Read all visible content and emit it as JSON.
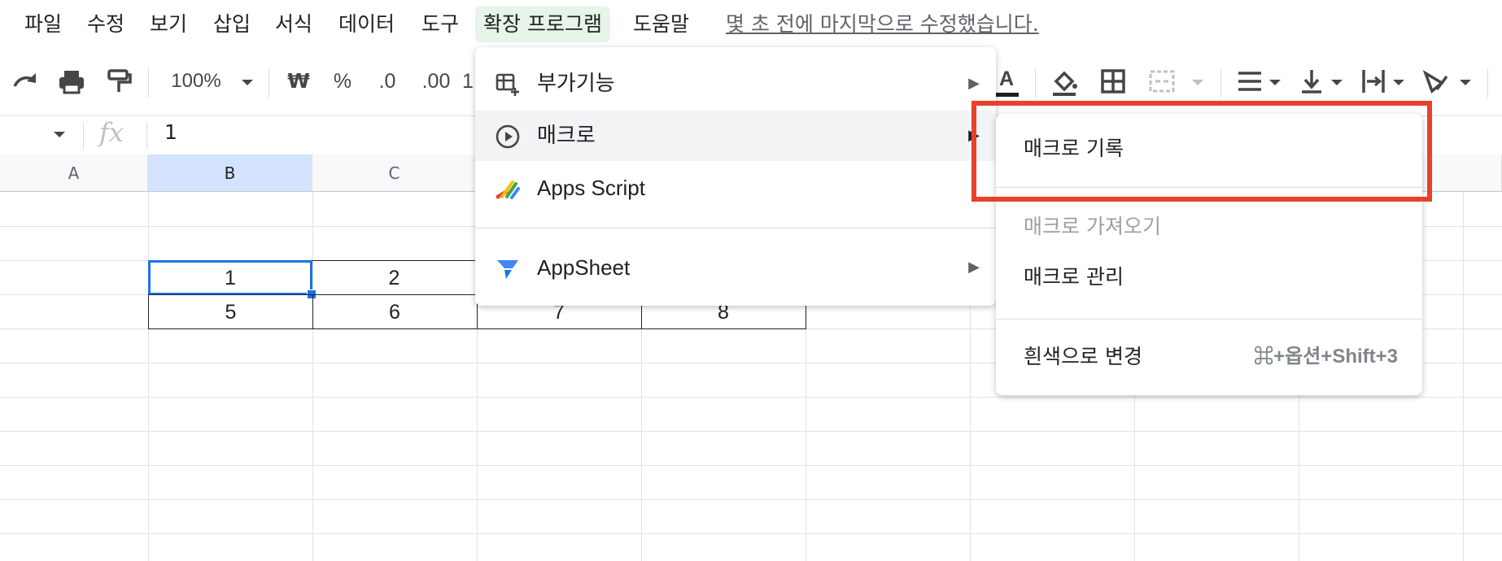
{
  "menubar": {
    "items": [
      "파일",
      "수정",
      "보기",
      "삽입",
      "서식",
      "데이터",
      "도구",
      "확장 프로그램",
      "도움말"
    ],
    "last_edit": "몇 초 전에 마지막으로 수정했습니다."
  },
  "toolbar": {
    "zoom": "100%",
    "currency": "₩",
    "percent": "%",
    "decrease_decimal": ".0",
    "increase_decimal": ".00",
    "partial_number": "1",
    "text_color_glyph": "A"
  },
  "formula_bar": {
    "fx": "fx",
    "value": "1"
  },
  "columns": [
    "A",
    "B",
    "C"
  ],
  "cells": {
    "row1": [
      "1",
      "2"
    ],
    "row2": [
      "5",
      "6",
      "7",
      "8"
    ]
  },
  "extensions_menu": {
    "items": [
      {
        "label": "부가기능",
        "icon": "addon-icon",
        "has_submenu": true
      },
      {
        "label": "매크로",
        "icon": "play-circle-icon",
        "has_submenu": true
      },
      {
        "label": "Apps Script",
        "icon": "apps-script-icon",
        "has_submenu": false
      },
      {
        "label": "AppSheet",
        "icon": "appsheet-icon",
        "has_submenu": true
      }
    ],
    "arrow": "▶"
  },
  "macro_submenu": {
    "record": "매크로 기록",
    "import": "매크로 가져오기",
    "manage": "매크로 관리",
    "saved_macro": "흰색으로 변경",
    "saved_macro_shortcut": "⌘+옵션+Shift+3"
  },
  "colors": {
    "highlight_box": "#e8402b",
    "active_menu_bg": "#e6f4ea",
    "selection_blue": "#1a73e8"
  }
}
